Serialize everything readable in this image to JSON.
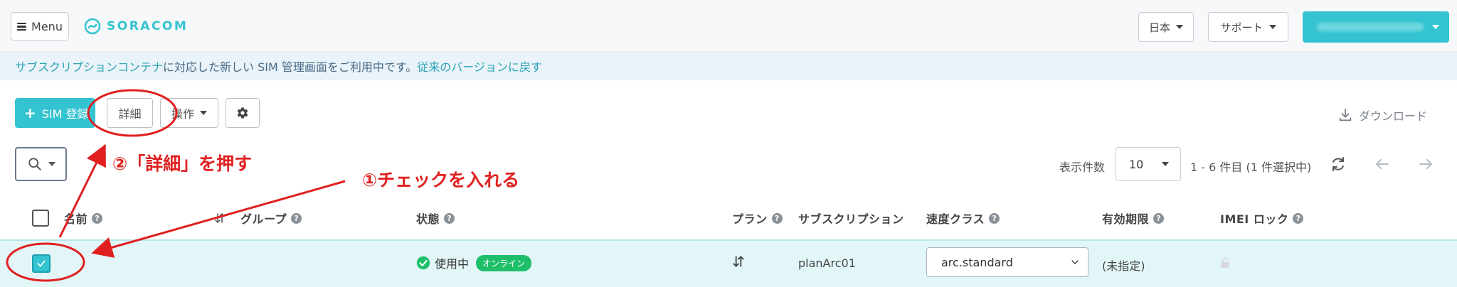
{
  "header": {
    "menu_label": "Menu",
    "logo_text": "SORACOM",
    "language_label": "日本",
    "support_label": "サポート",
    "account_label": ""
  },
  "notice": {
    "link_text": "サブスクリプションコンテナ",
    "text_middle": "に対応した新しい SIM 管理画面をご利用中です。",
    "revert_link": "従来のバージョンに戻す"
  },
  "toolbar": {
    "register_label": "SIM 登録",
    "details_label": "詳細",
    "operations_label": "操作",
    "download_label": "ダウンロード"
  },
  "pagination": {
    "per_page_label": "表示件数",
    "per_page_value": "10",
    "range_text": "1 - 6 件目 (1 件選択中)"
  },
  "table": {
    "columns": {
      "name": "名前",
      "group": "グループ",
      "status": "状態",
      "plan": "プラン",
      "subscription": "サブスクリプション",
      "speed_class": "速度クラス",
      "expiry": "有効期限",
      "imei_lock": "IMEI ロック"
    },
    "rows": [
      {
        "name": "",
        "group": "",
        "status": "使用中",
        "online_badge": "オンライン",
        "subscription": "planArc01",
        "speed_class": "arc.standard",
        "expiry": "(未指定)"
      }
    ]
  },
  "annotations": {
    "step1": "①チェックを入れる",
    "step2": "②「詳細」を押す",
    "color": "#e02020"
  },
  "colors": {
    "accent": "#34c3d0",
    "online": "#1fbf6a",
    "selected_row": "#e2f6f8"
  }
}
